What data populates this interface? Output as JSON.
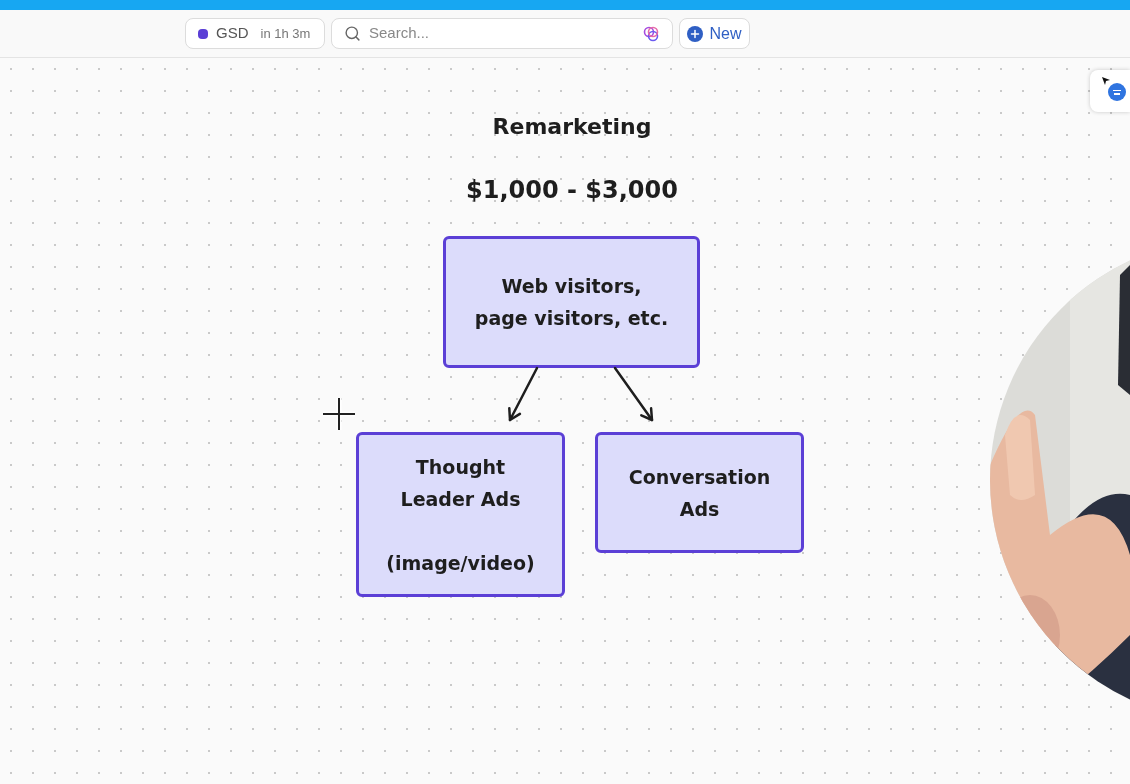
{
  "toolbar": {
    "timer": {
      "label": "GSD",
      "time": "in 1h 3m"
    },
    "search": {
      "placeholder": "Search..."
    },
    "new_button": "New"
  },
  "canvas": {
    "title": "Remarketing",
    "budget": "$1,000 - $3,000",
    "nodes": [
      {
        "text": "Web visitors,\npage visitors, etc."
      },
      {
        "text": "Thought\nLeader Ads\n\n(image/video)"
      },
      {
        "text": "Conversation\nAds"
      }
    ]
  }
}
